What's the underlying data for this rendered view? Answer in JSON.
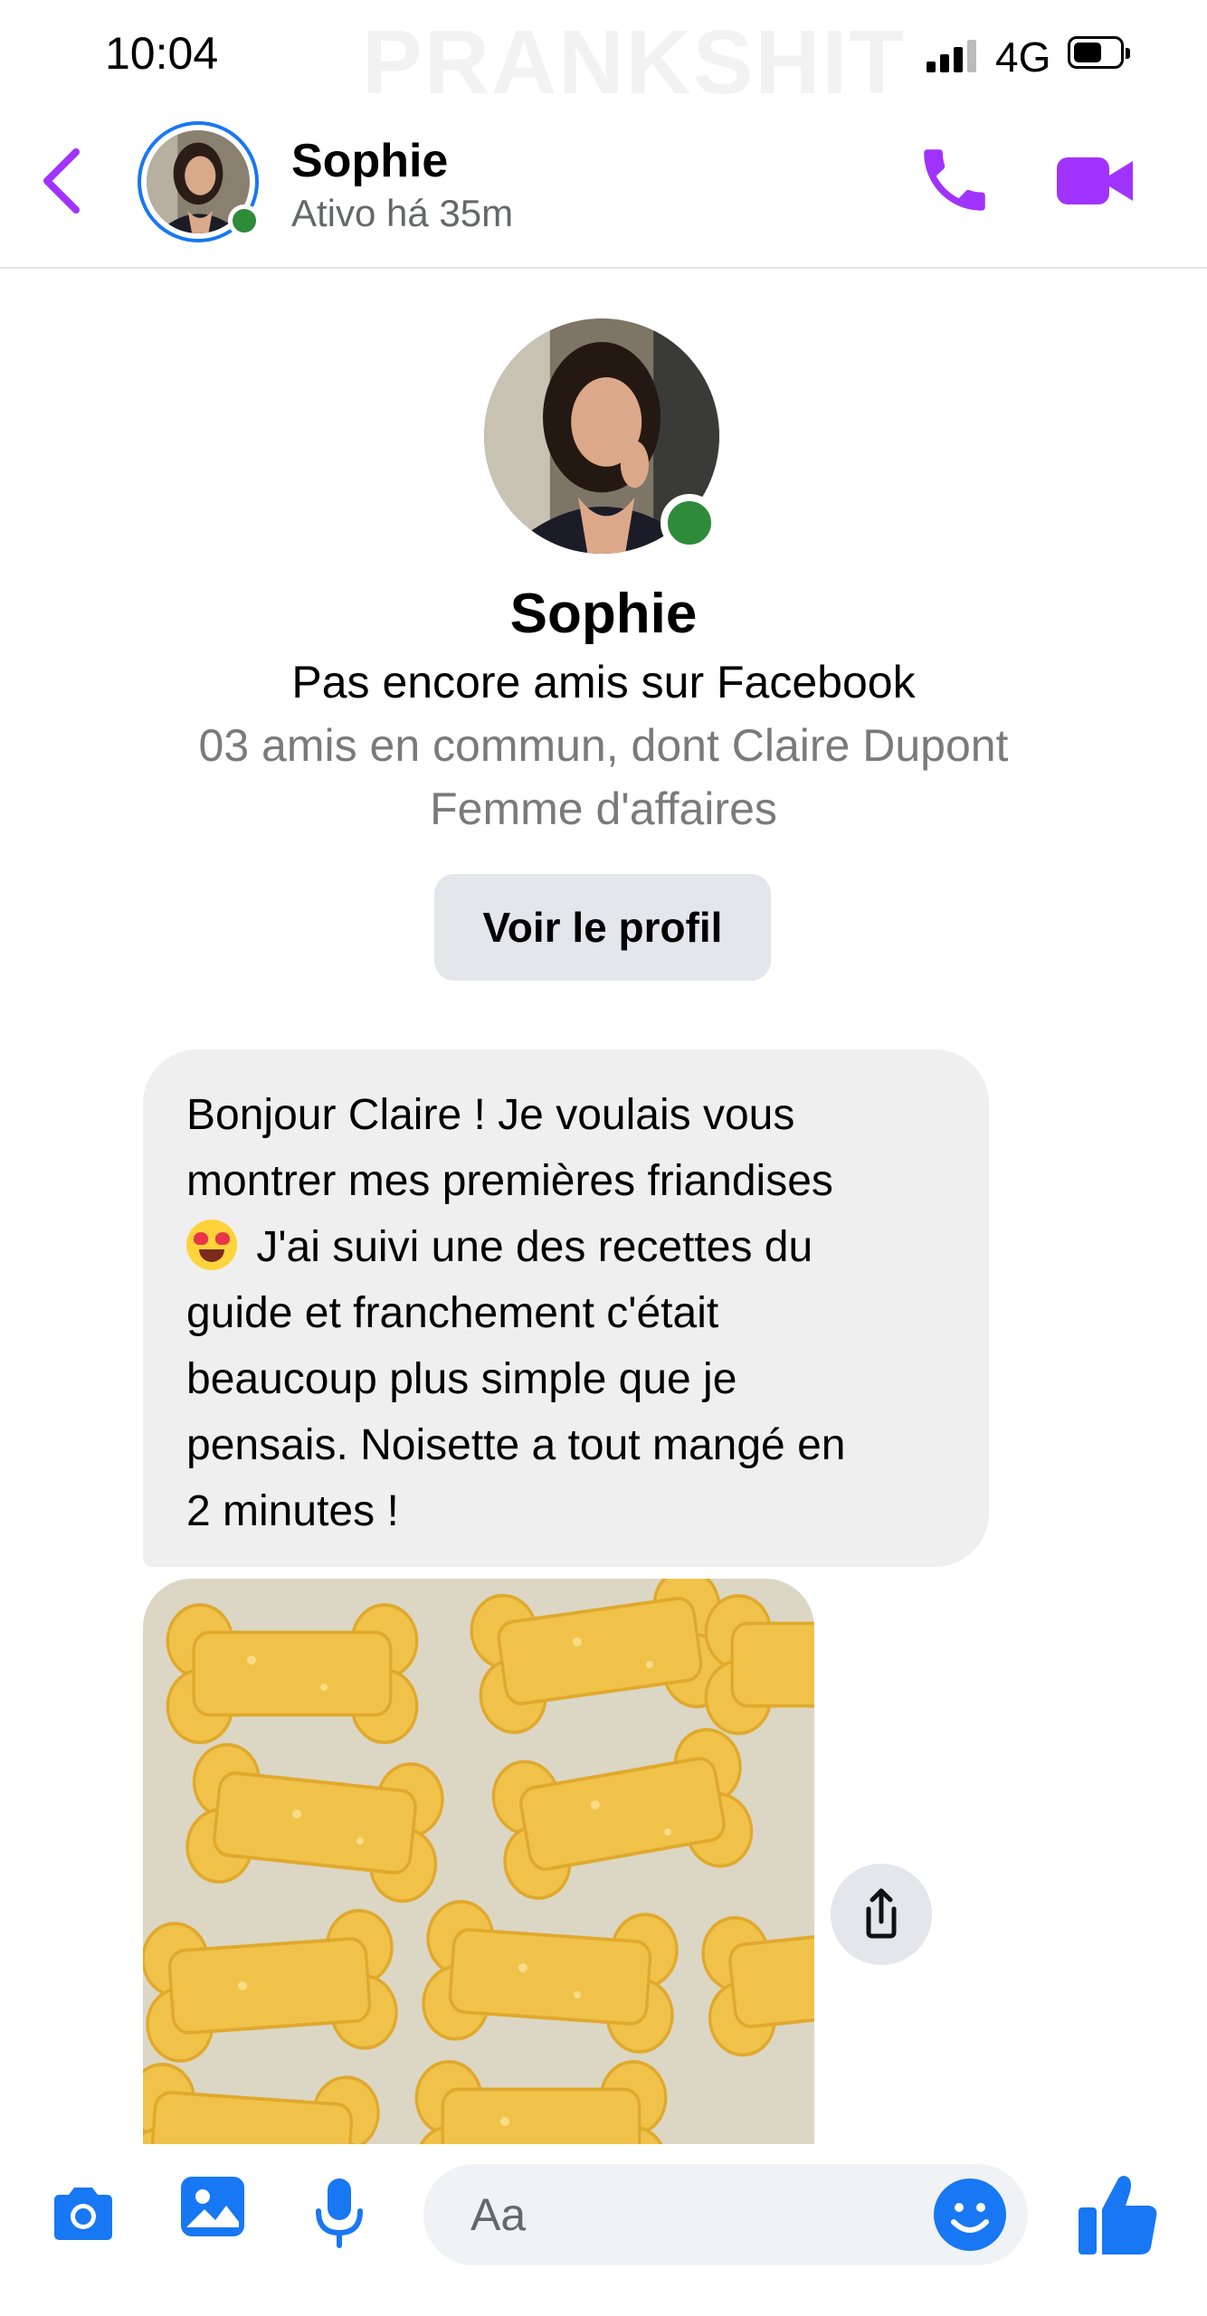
{
  "status_bar": {
    "time": "10:04",
    "network": "4G",
    "watermark": "PRANKSHIT"
  },
  "header": {
    "name": "Sophie",
    "status": "Ativo há 35m",
    "accent": "#a033ff"
  },
  "profile": {
    "name": "Sophie",
    "relationship": "Pas encore amis sur Facebook",
    "mutual": "03 amis en commun, dont Claire Dupont",
    "occupation": "Femme d'affaires",
    "view_profile_label": "Voir le profil"
  },
  "message": {
    "line1": "Bonjour Claire ! Je voulais vous",
    "line2": "montrer mes premières friandises",
    "emoji": "heart-eyes-emoji",
    "line3": "J'ai suivi une des recettes du",
    "line4": "guide et franchement c'était",
    "line5": "beaucoup plus simple que je",
    "line6": "pensais. Noisette a tout mangé en",
    "line7": "2 minutes !"
  },
  "composer": {
    "placeholder": "Aa",
    "icons": [
      "camera-icon",
      "gallery-icon",
      "microphone-icon",
      "emoji-icon",
      "thumbs-up-icon"
    ],
    "blue": "#1877f2"
  },
  "colors": {
    "online": "#2e8b3a",
    "bubble": "#efefef",
    "button": "#e4e6eb"
  }
}
